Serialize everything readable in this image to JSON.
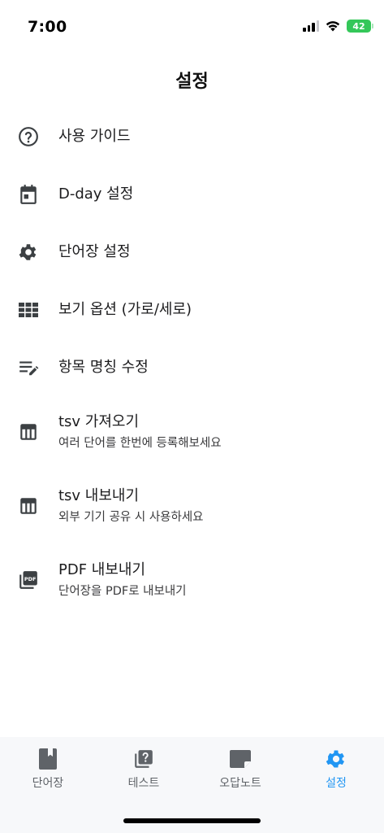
{
  "status": {
    "time": "7:00",
    "battery": "42"
  },
  "header": {
    "title": "설정"
  },
  "menu": {
    "items": [
      {
        "label": "사용 가이드",
        "icon": "help-circle-icon"
      },
      {
        "label": "D-day 설정",
        "icon": "calendar-icon"
      },
      {
        "label": "단어장 설정",
        "icon": "gear-icon"
      },
      {
        "label": "보기 옵션 (가로/세로)",
        "icon": "grid-view-icon"
      },
      {
        "label": "항목 명칭 수정",
        "icon": "edit-list-icon"
      },
      {
        "label": "tsv 가져오기",
        "sub": "여러 단어를 한번에 등록해보세요",
        "icon": "table-icon"
      },
      {
        "label": "tsv 내보내기",
        "sub": "외부 기기 공유 시 사용하세요",
        "icon": "table-icon"
      },
      {
        "label": "PDF 내보내기",
        "sub": "단어장을 PDF로 내보내기",
        "icon": "pdf-icon"
      }
    ]
  },
  "tabs": [
    {
      "label": "단어장",
      "icon": "book-icon"
    },
    {
      "label": "테스트",
      "icon": "quiz-icon"
    },
    {
      "label": "오답노트",
      "icon": "note-icon"
    },
    {
      "label": "설정",
      "icon": "gear-icon",
      "active": true
    }
  ],
  "colors": {
    "accent": "#2196f3",
    "icon": "#3c4043",
    "tab_icon": "#5f6368",
    "battery": "#34c759"
  }
}
